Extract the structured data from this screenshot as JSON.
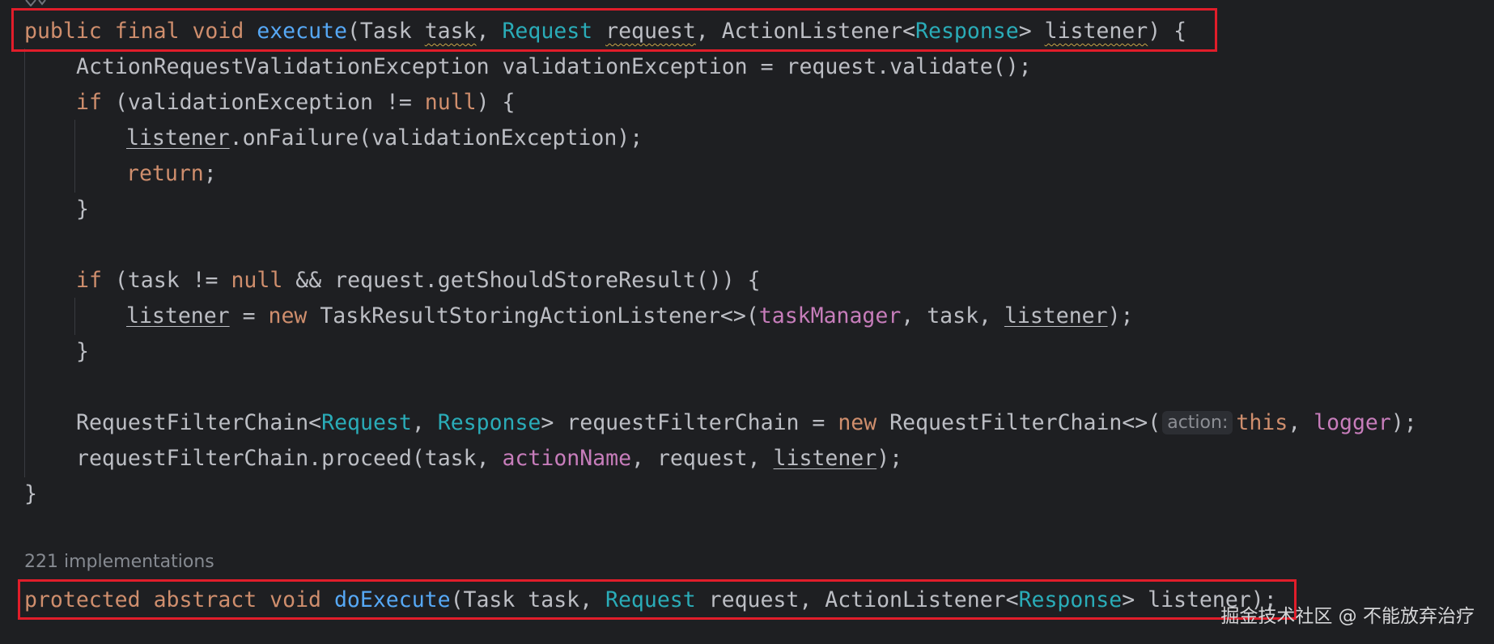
{
  "editor": {
    "line1": {
      "kw_public": "public",
      "kw_final": "final",
      "kw_void": "void",
      "method": "execute",
      "open": "(",
      "type_task": "Task",
      "param_task": "task",
      "comma1": ", ",
      "type_request": "Request",
      "param_request": "request",
      "comma2": ", ",
      "type_listener": "ActionListener<",
      "type_response": "Response",
      "gt": "> ",
      "param_listener": "listener",
      "close": ") {"
    },
    "line2": {
      "text": "ActionRequestValidationException validationException = request.validate();"
    },
    "line3": {
      "kw_if": "if",
      "rest_a": " (validationException != ",
      "kw_null": "null",
      "rest_b": ") {"
    },
    "line4": {
      "var": "listener",
      "rest": ".onFailure(validationException);"
    },
    "line5": {
      "kw_return": "return",
      "semi": ";"
    },
    "line6": {
      "text": "}"
    },
    "line8": {
      "kw_if": "if",
      "rest_a": " (task != ",
      "kw_null": "null",
      "rest_b": " && request.getShouldStoreResult()) {"
    },
    "line9": {
      "var": "listener",
      "eq": " = ",
      "kw_new": "new",
      "cls": " TaskResultStoringActionListener<>(",
      "field": "taskManager",
      "mid": ", task, ",
      "var2": "listener",
      "end": ");"
    },
    "line10": {
      "text": "}"
    },
    "line12": {
      "cls_a": "RequestFilterChain<",
      "type_request": "Request",
      "comma": ", ",
      "type_response": "Response",
      "rest_a": "> requestFilterChain = ",
      "kw_new": "new",
      "rest_b": " RequestFilterChain<>(",
      "hint": "action:",
      "kw_this": "this",
      "comma2": ", ",
      "field": "logger",
      "end": ");"
    },
    "line13": {
      "rest_a": "requestFilterChain.proceed(task, ",
      "field": "actionName",
      "rest_b": ", request, ",
      "var": "listener",
      "end": ");"
    },
    "line14": {
      "text": "}"
    },
    "implementations": "221 implementations",
    "line16": {
      "kw_protected": "protected",
      "kw_abstract": "abstract",
      "kw_void": "void",
      "method": "doExecute",
      "open": "(Task task, ",
      "type_request": "Request",
      "mid": " request, ActionListener<",
      "type_response": "Response",
      "end": "> listener);"
    }
  },
  "watermark": "掘金技术社区 @ 不能放弃治疗",
  "colors": {
    "background": "#1e1f22",
    "keyword": "#cf8e6d",
    "method": "#56a8f5",
    "type": "#2aacb8",
    "field": "#c77dbb",
    "text": "#bcbec4",
    "highlight_box": "#e11d2a"
  }
}
